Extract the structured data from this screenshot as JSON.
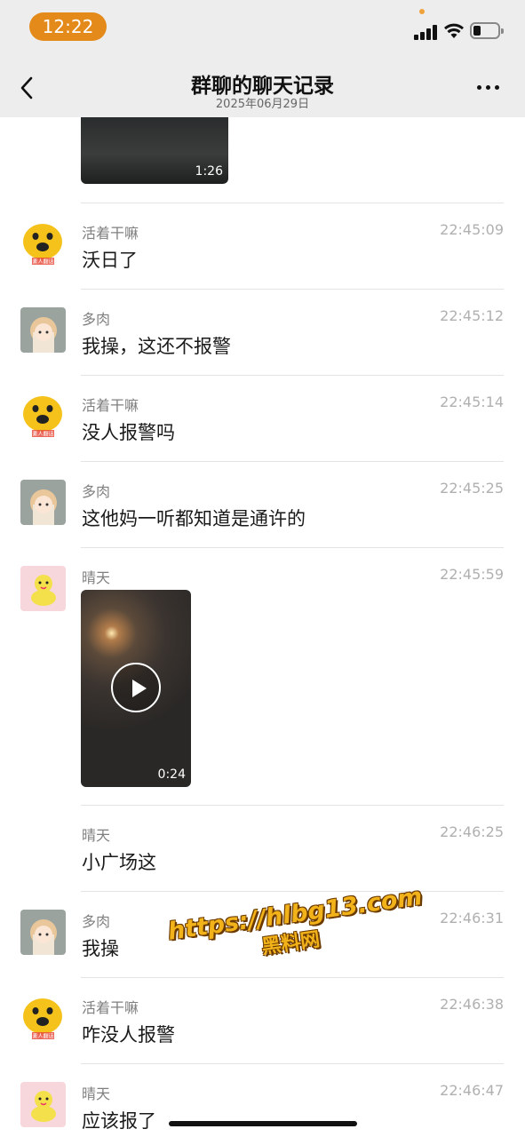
{
  "status_bar": {
    "time": "12:22"
  },
  "nav": {
    "title": "群聊的聊天记录",
    "subtitle": "2025年06月29日"
  },
  "top_video": {
    "duration": "1:26"
  },
  "messages": [
    {
      "sender": "活着干嘛",
      "time": "22:45:09",
      "text": "沃日了",
      "avatar": "dog-avatar"
    },
    {
      "sender": "多肉",
      "time": "22:45:12",
      "text": "我操，这还不报警",
      "avatar": "anime-girl-avatar"
    },
    {
      "sender": "活着干嘛",
      "time": "22:45:14",
      "text": "没人报警吗",
      "avatar": "dog-avatar"
    },
    {
      "sender": "多肉",
      "time": "22:45:25",
      "text": "这他妈一听都知道是通许的",
      "avatar": "anime-girl-avatar"
    },
    {
      "sender": "晴天",
      "time": "22:45:59",
      "video_duration": "0:24",
      "avatar": "cartoon-chick-avatar"
    },
    {
      "sender": "晴天",
      "time": "22:46:25",
      "text": "小广场这"
    },
    {
      "sender": "多肉",
      "time": "22:46:31",
      "text": "我操",
      "avatar": "anime-girl-avatar"
    },
    {
      "sender": "活着干嘛",
      "time": "22:46:38",
      "text": "咋没人报警",
      "avatar": "dog-avatar"
    },
    {
      "sender": "晴天",
      "time": "22:46:47",
      "text": "应该报了",
      "avatar": "cartoon-chick-avatar"
    }
  ],
  "avatar_badge_text": "素人翻话",
  "watermark": {
    "url": "https://hlbg13.com",
    "label": "黑料网"
  },
  "colors": {
    "accent": "#e48a1a",
    "header_bg": "#ededed",
    "divider": "#e3e3e3",
    "watermark": "#f2b21a"
  }
}
